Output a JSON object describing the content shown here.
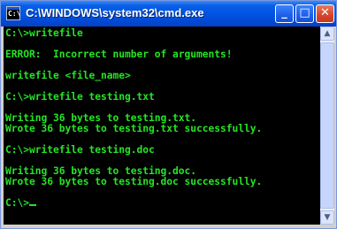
{
  "window": {
    "title": "C:\\WINDOWS\\system32\\cmd.exe",
    "icon": "cmd-icon",
    "icon_glyph": "C:\\",
    "controls": {
      "minimize": "_",
      "maximize": "□",
      "close": "✕"
    }
  },
  "console": {
    "lines": [
      "C:\\>writefile",
      "",
      "ERROR:  Incorrect number of arguments!",
      "",
      "writefile <file_name>",
      "",
      "C:\\>writefile testing.txt",
      "",
      "Writing 36 bytes to testing.txt.",
      "Wrote 36 bytes to testing.txt successfully.",
      "",
      "C:\\>writefile testing.doc",
      "",
      "Writing 36 bytes to testing.doc.",
      "Wrote 36 bytes to testing.doc successfully.",
      "",
      "C:\\>"
    ],
    "text_color": "#25e425",
    "background": "#000000"
  },
  "scrollbar": {
    "up": "▲",
    "down": "▼"
  }
}
